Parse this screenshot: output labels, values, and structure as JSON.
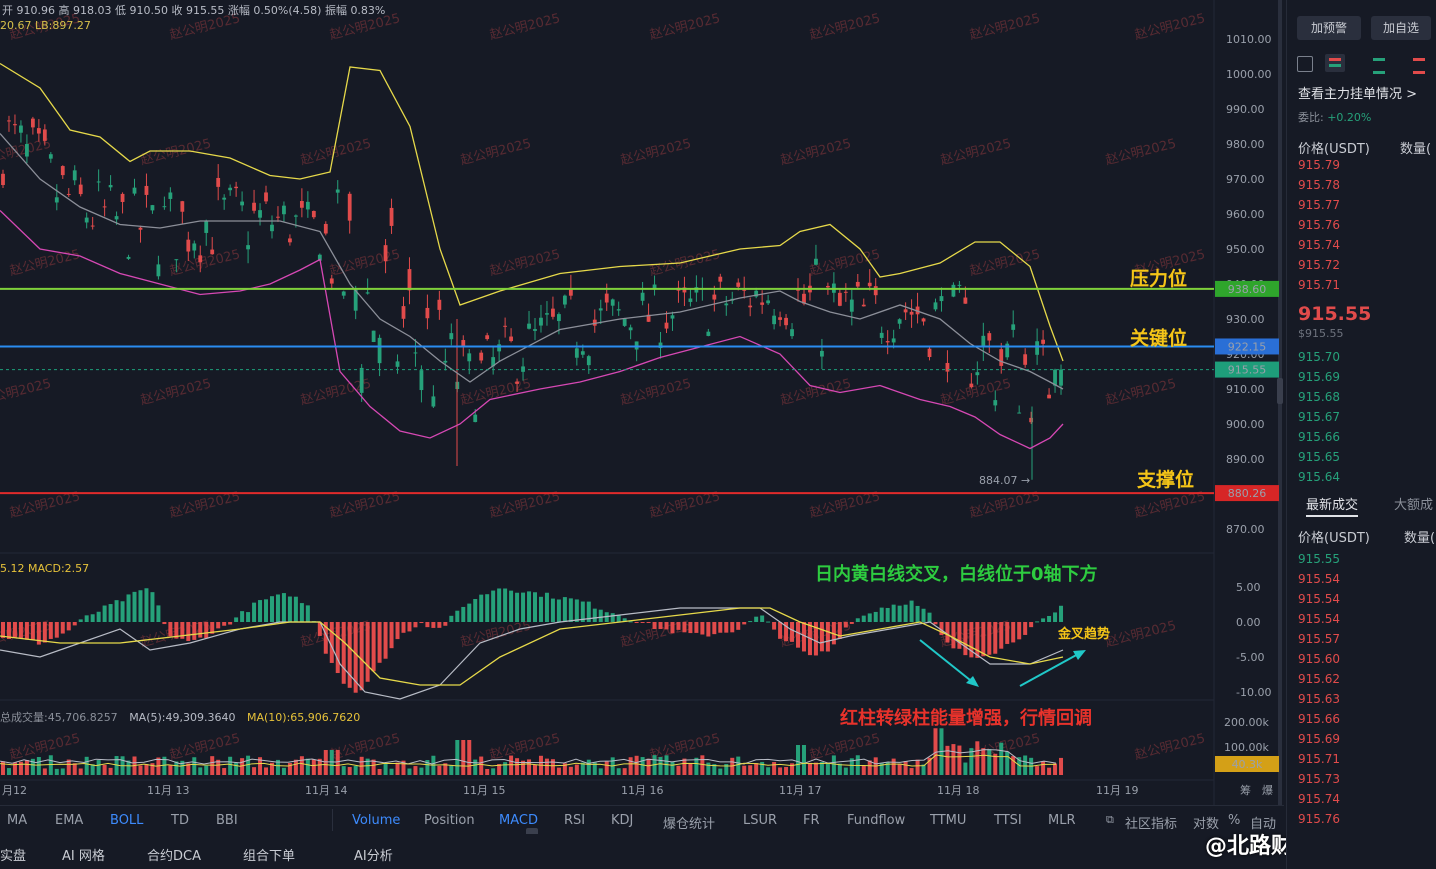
{
  "header": {
    "ohlc": "开 910.96  高 918.03  低 910.50  收 915.55  涨幅 0.50%(4.58)  振幅 0.83%",
    "boll": "20.67  LB:897.27",
    "macd": "5.12  MACD:2.57",
    "vol_label": "总成交量:45,706.8257",
    "vol_ma5": "MA(5):49,309.3640",
    "vol_ma10": "MA(10):65,906.7620"
  },
  "watermark": "赵公明2025",
  "price_axis": [
    "1010.00",
    "1000.00",
    "990.00",
    "980.00",
    "970.00",
    "960.00",
    "950.00",
    "940.00",
    "930.00",
    "920.00",
    "910.00",
    "900.00",
    "890.00",
    "880.00",
    "870.00"
  ],
  "macd_axis": [
    "5.00",
    "0.00",
    "-5.00",
    "-10.00"
  ],
  "vol_axis": [
    "200.00k",
    "100.00k"
  ],
  "time_axis": [
    "月12",
    "11月 13",
    "11月 14",
    "11月 15",
    "11月 16",
    "11月 17",
    "11月 18",
    "11月 19"
  ],
  "levels": {
    "resistance": {
      "label": "压力位",
      "value": "938.60",
      "color": "#7fd13b"
    },
    "key": {
      "label": "关键位",
      "value": "922.15",
      "color": "#2a8cf0"
    },
    "last": {
      "value": "915.55",
      "color": "#1e9e7a"
    },
    "support": {
      "label": "支撑位",
      "value": "880.26",
      "color": "#e12b2b"
    }
  },
  "low_marker": "884.07 →",
  "vol_badge": "40.3k",
  "annotations": {
    "macd_note": "日内黄白线交叉，白线位于0轴下方",
    "golden_cross": "金叉趋势",
    "volume_note": "红柱转绿柱能量增强，行情回调"
  },
  "indicator_bar": {
    "main": [
      "MA",
      "EMA",
      "BOLL",
      "TD",
      "BBI"
    ],
    "main_active": "BOLL",
    "sub": [
      "Volume",
      "Position",
      "MACD",
      "RSI",
      "KDJ",
      "爆仓统计",
      "LSUR",
      "FR",
      "Fundflow",
      "TTMU",
      "TTSI",
      "MLR"
    ],
    "sub_active": [
      "Volume",
      "MACD"
    ],
    "community": "社区指标",
    "log": "对数",
    "pct": "%",
    "auto": "自动",
    "chip": "筹",
    "liq": "爆"
  },
  "bottom_bar": [
    "实盘",
    "AI 网格",
    "组合下单",
    "合约DCA",
    "AI分析"
  ],
  "weibo": "@北路财神赵公明",
  "right_panel": {
    "btn_alert": "加预警",
    "btn_fav": "加自选",
    "depth_link": "查看主力挂单情况 >",
    "ratio_label": "委比:",
    "ratio_value": "+0.20%",
    "col_price": "价格(USDT)",
    "col_qty": "数量(",
    "asks": [
      "915.79",
      "915.78",
      "915.77",
      "915.76",
      "915.74",
      "915.72",
      "915.71"
    ],
    "last_price": "915.55",
    "last_sub": "$915.55",
    "bids": [
      "915.70",
      "915.69",
      "915.68",
      "915.67",
      "915.66",
      "915.65",
      "915.64"
    ],
    "trades_tab": "最新成交",
    "big_tab": "大额成",
    "trades_col_price": "价格(USDT)",
    "trades_col_qty": "数量(",
    "trades": [
      {
        "p": "915.55",
        "c": "bid"
      },
      {
        "p": "915.54",
        "c": "ask"
      },
      {
        "p": "915.54",
        "c": "ask"
      },
      {
        "p": "915.54",
        "c": "ask"
      },
      {
        "p": "915.57",
        "c": "ask"
      },
      {
        "p": "915.60",
        "c": "ask"
      },
      {
        "p": "915.62",
        "c": "ask"
      },
      {
        "p": "915.63",
        "c": "ask"
      },
      {
        "p": "915.66",
        "c": "ask"
      },
      {
        "p": "915.69",
        "c": "ask"
      },
      {
        "p": "915.71",
        "c": "ask"
      },
      {
        "p": "915.73",
        "c": "ask"
      },
      {
        "p": "915.74",
        "c": "ask"
      },
      {
        "p": "915.76",
        "c": "ask"
      }
    ]
  }
}
